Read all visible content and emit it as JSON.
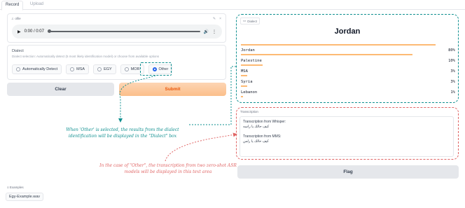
{
  "tabs": [
    {
      "label": "Record"
    },
    {
      "label": "Upload"
    }
  ],
  "audio": {
    "label": "ofile",
    "time": "0:00 / 0:07"
  },
  "dialect_input": {
    "title": "Dialect",
    "info": "Dialect selection: Automatically detect (5 most likely identification model) or choose from available options",
    "options": [
      "Automatically Detect",
      "MSA",
      "EGY",
      "MOR",
      "Other"
    ],
    "selected": "Other"
  },
  "buttons": {
    "clear": "Clear",
    "submit": "Submit",
    "flag": "Flag"
  },
  "dialect_output": {
    "label": "Dialect",
    "top_label": "Jordan",
    "confidences": [
      {
        "label": "Jordan",
        "value": "80%",
        "fraction": 0.8
      },
      {
        "label": "Palestine",
        "value": "10%",
        "fraction": 0.1
      },
      {
        "label": "MSA",
        "value": "3%",
        "fraction": 0.03
      },
      {
        "label": "Syria",
        "value": "3%",
        "fraction": 0.03
      },
      {
        "label": "Lebanon",
        "value": "1%",
        "fraction": 0.01
      }
    ]
  },
  "transcription": {
    "label": "Transcription",
    "whisper_label": "Transcription from Whisper:",
    "whisper_text": "كيف حالك يا راسه",
    "mms_label": "Transcription from MMS:",
    "mms_text": "كيف حالك يا رلس"
  },
  "annotations": {
    "green": "When 'Other' is selected, the results from the dialect identification will be displayed in the \"Dialect\" box",
    "red": "In the case of \"Other\", the transcription from two zero-shot ASR models will be displayed in this text area"
  },
  "examples": {
    "label": "Examples",
    "items": [
      "Egy-Example.wav"
    ]
  },
  "colors": {
    "teal": "#0e8f8f",
    "coral": "#e06565",
    "accent": "#fdba74"
  }
}
